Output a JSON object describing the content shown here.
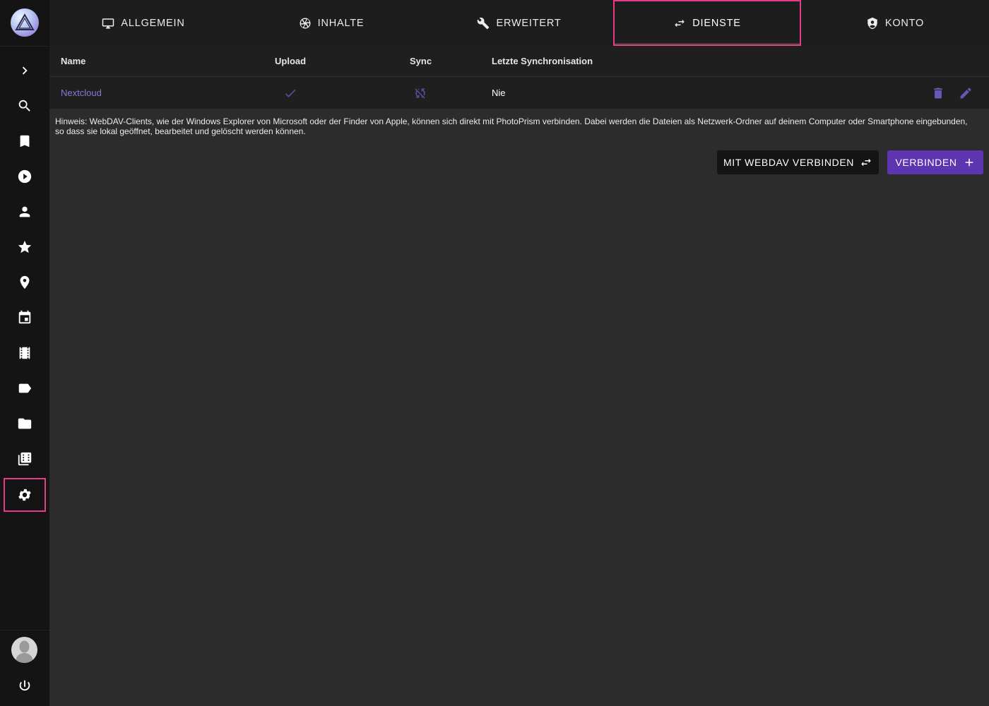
{
  "sidebar": {
    "items": [
      {
        "name": "expand-icon"
      },
      {
        "name": "search-icon"
      },
      {
        "name": "bookmark-icon"
      },
      {
        "name": "play-icon"
      },
      {
        "name": "person-icon"
      },
      {
        "name": "star-icon"
      },
      {
        "name": "location-pin-icon"
      },
      {
        "name": "calendar-icon"
      },
      {
        "name": "film-icon"
      },
      {
        "name": "label-icon"
      },
      {
        "name": "folder-icon"
      },
      {
        "name": "library-icon"
      },
      {
        "name": "settings-icon",
        "active": true
      }
    ],
    "bottom": [
      {
        "name": "avatar"
      },
      {
        "name": "power-icon"
      }
    ]
  },
  "tabs": [
    {
      "label": "ALLGEMEIN",
      "icon": "monitor-icon"
    },
    {
      "label": "INHALTE",
      "icon": "aperture-icon"
    },
    {
      "label": "ERWEITERT",
      "icon": "wrench-icon"
    },
    {
      "label": "DIENSTE",
      "icon": "swap-icon",
      "active": true
    },
    {
      "label": "KONTO",
      "icon": "account-shield-icon"
    }
  ],
  "table": {
    "headers": {
      "name": "Name",
      "upload": "Upload",
      "sync": "Sync",
      "last_sync": "Letzte Synchronisation"
    },
    "rows": [
      {
        "name": "Nextcloud",
        "upload": "check-icon",
        "sync": "sync-off-icon",
        "last_sync": "Nie"
      }
    ]
  },
  "hint": "Hinweis: WebDAV-Clients, wie der Windows Explorer von Microsoft oder der Finder von Apple, können sich direkt mit PhotoPrism verbinden. Dabei werden die Dateien als Netzwerk-Ordner auf deinem Computer oder Smartphone eingebunden, so dass sie lokal geöffnet, bearbeitet und gelöscht werden können.",
  "buttons": {
    "webdav": "MIT WEBDAV VERBINDEN",
    "connect": "VERBINDEN"
  },
  "colors": {
    "accent": "#5e35b1",
    "link": "#8a76d6",
    "highlight": "#e63b8a"
  }
}
